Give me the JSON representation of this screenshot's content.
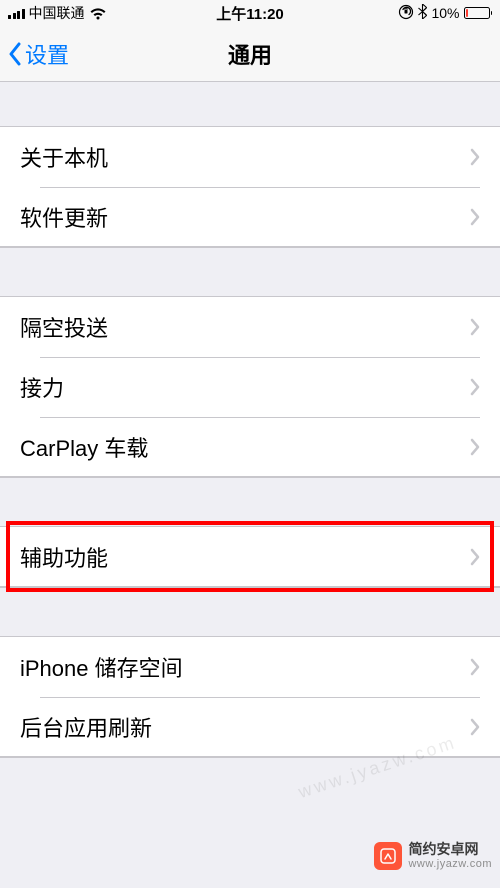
{
  "status": {
    "carrier": "中国联通",
    "time": "上午11:20",
    "battery_pct": "10%"
  },
  "nav": {
    "back": "设置",
    "title": "通用"
  },
  "groups": [
    {
      "items": [
        {
          "key": "about",
          "label": "关于本机"
        },
        {
          "key": "software-update",
          "label": "软件更新"
        }
      ]
    },
    {
      "items": [
        {
          "key": "airdrop",
          "label": "隔空投送"
        },
        {
          "key": "handoff",
          "label": "接力"
        },
        {
          "key": "carplay",
          "label": "CarPlay 车载"
        }
      ]
    },
    {
      "items": [
        {
          "key": "accessibility",
          "label": "辅助功能",
          "highlighted": true
        }
      ]
    },
    {
      "items": [
        {
          "key": "iphone-storage",
          "label": "iPhone 储存空间"
        },
        {
          "key": "background-refresh",
          "label": "后台应用刷新"
        }
      ]
    }
  ],
  "watermark": {
    "title": "简约安卓网",
    "sub": "www.jyazw.com",
    "diag": "www.jyazw.com"
  }
}
